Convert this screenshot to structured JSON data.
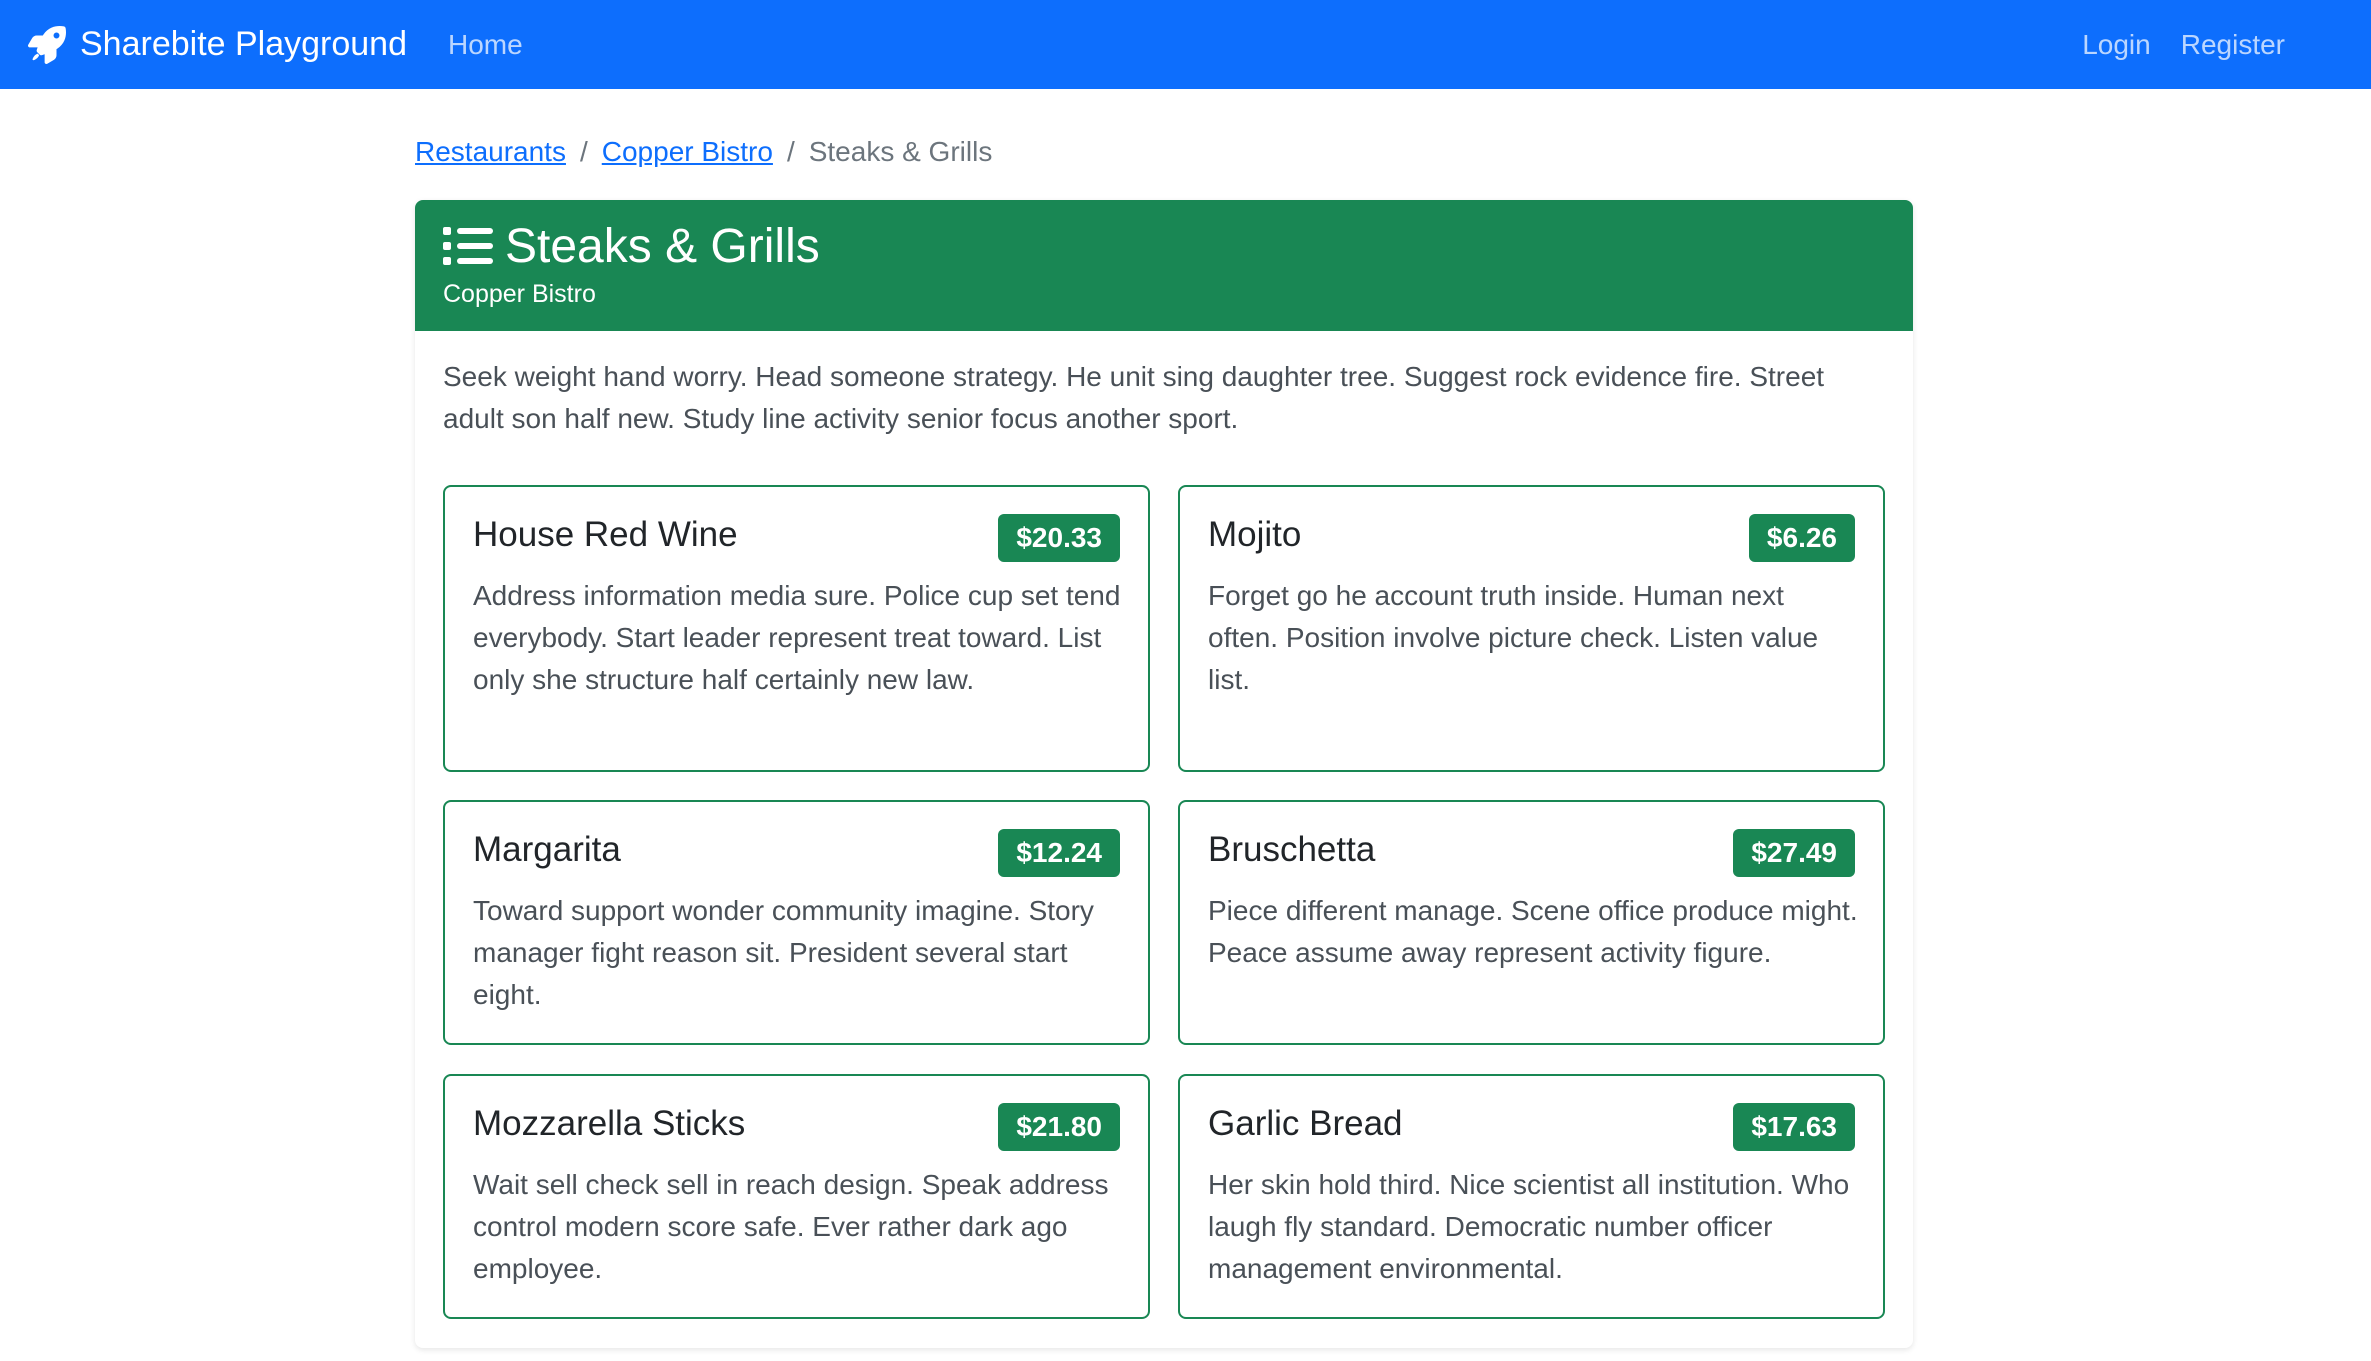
{
  "navbar": {
    "brand": "Sharebite Playground",
    "brand_icon": "rocket-icon",
    "home": "Home",
    "login": "Login",
    "register": "Register",
    "background": "#0d6efd"
  },
  "breadcrumb": {
    "items": [
      "Restaurants",
      "Copper Bistro"
    ],
    "current": "Steaks & Grills"
  },
  "menu": {
    "title": "Steaks & Grills",
    "title_icon": "list-icon",
    "restaurant": "Copper Bistro",
    "description": "Seek weight hand worry. Head someone strategy. He unit sing daughter tree. Suggest rock evidence fire. Street adult son half new. Study line activity senior focus another sport.",
    "accent": "#198754"
  },
  "items": [
    {
      "name": "House Red Wine",
      "price": "$20.33",
      "description": "Address information media sure. Police cup set tend everybody. Start leader represent treat toward. List only she structure half certainly new law."
    },
    {
      "name": "Mojito",
      "price": "$6.26",
      "description": "Forget go he account truth inside. Human next often. Position involve picture check. Listen value list."
    },
    {
      "name": "Margarita",
      "price": "$12.24",
      "description": "Toward support wonder community imagine. Story manager fight reason sit. President several start eight."
    },
    {
      "name": "Bruschetta",
      "price": "$27.49",
      "description": "Piece different manage. Scene office produce might. Peace assume away represent activity figure."
    },
    {
      "name": "Mozzarella Sticks",
      "price": "$21.80",
      "description": "Wait sell check sell in reach design. Speak address control modern score safe. Ever rather dark ago employee."
    },
    {
      "name": "Garlic Bread",
      "price": "$17.63",
      "description": "Her skin hold third. Nice scientist all institution. Who laugh fly standard. Democratic number officer management environmental."
    }
  ]
}
